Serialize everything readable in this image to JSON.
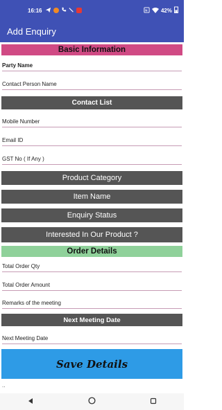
{
  "status_bar": {
    "time": "16:16",
    "battery_percent": "42%",
    "left_icons": [
      "telegram-icon",
      "swiggy-icon",
      "phone-icon",
      "missed-call-icon",
      "mail-icon"
    ],
    "right_icons": [
      "nfc-icon",
      "wifi-icon",
      "battery-icon"
    ]
  },
  "app_bar": {
    "title": "Add Enquiry"
  },
  "sections": {
    "basic_info": "Basic Information",
    "contact_list": "Contact List",
    "order_details": "Order Details",
    "next_meeting": "Next Meeting Date"
  },
  "fields": {
    "party_name": "Party Name",
    "contact_person": "Contact Person Name",
    "mobile": "Mobile Number",
    "email": "Email ID",
    "gst": "GST No ( If Any )",
    "total_qty": "Total Order Qty",
    "total_amount": "Total Order Amount",
    "remarks": "Remarks of the meeting",
    "next_meeting_date": "Next Meeting Date"
  },
  "dropdowns": {
    "product_category": "Product Category",
    "item_name": "Item Name",
    "enquiry_status": "Enquiry Status",
    "interested": "Interested In Our Product ?"
  },
  "save_button": "Save Details",
  "footer_text": "..",
  "colors": {
    "primary": "#3f51b5",
    "section_pink": "#d04a84",
    "section_green": "#8fd19a",
    "dark_button": "#555555",
    "save_blue": "#2e9be6"
  }
}
